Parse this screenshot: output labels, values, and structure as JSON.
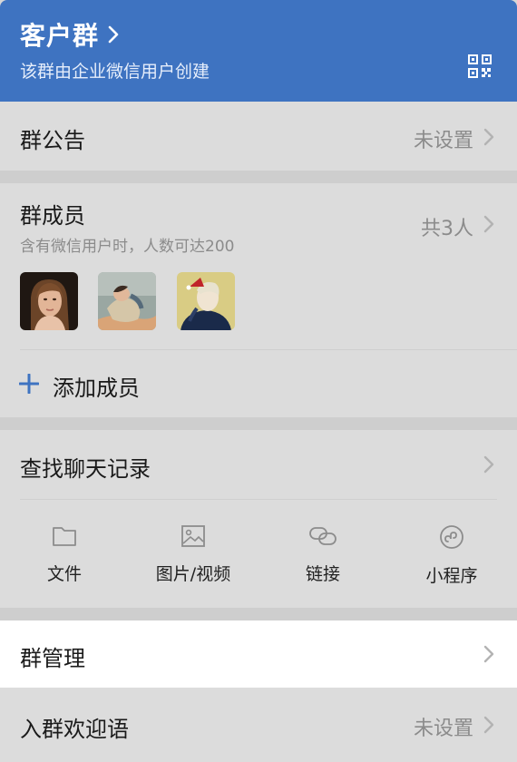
{
  "header": {
    "title": "客户群",
    "subtitle": "该群由企业微信用户创建"
  },
  "announcement": {
    "label": "群公告",
    "value": "未设置"
  },
  "members": {
    "label": "群成员",
    "note": "含有微信用户时，人数可达200",
    "count": "共3人",
    "avatars": [
      "member-avatar-1",
      "member-avatar-2",
      "member-avatar-3"
    ],
    "add_label": "添加成员"
  },
  "history": {
    "label": "查找聊天记录",
    "tools": [
      {
        "label": "文件",
        "icon": "folder-icon"
      },
      {
        "label": "图片/视频",
        "icon": "image-icon"
      },
      {
        "label": "链接",
        "icon": "link-icon"
      },
      {
        "label": "小程序",
        "icon": "mini-program-icon"
      }
    ]
  },
  "manage": {
    "label": "群管理"
  },
  "welcome": {
    "label": "入群欢迎语",
    "value": "未设置"
  },
  "colors": {
    "accent": "#3e73c1",
    "muted": "#8b8b8b"
  }
}
